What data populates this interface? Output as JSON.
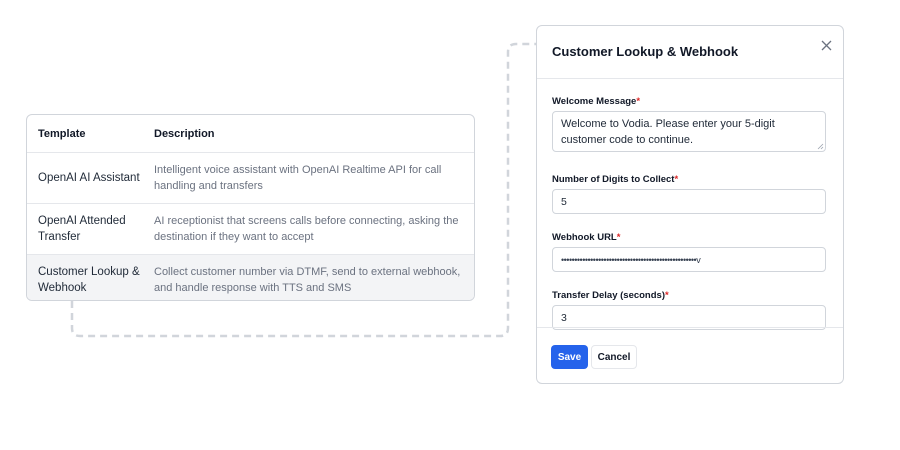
{
  "table": {
    "headers": {
      "template": "Template",
      "description": "Description"
    },
    "rows": [
      {
        "template": "OpenAI AI Assistant",
        "description": "Intelligent voice assistant with OpenAI Realtime API for call handling and transfers"
      },
      {
        "template": "OpenAI Attended Transfer",
        "description": "AI receptionist that screens calls before connecting, asking the destination if they want to accept"
      },
      {
        "template": "Customer Lookup & Webhook",
        "description": "Collect customer number via DTMF, send to external webhook, and handle response with TTS and SMS"
      }
    ]
  },
  "modal": {
    "title": "Customer Lookup & Webhook",
    "close_icon": "close-icon",
    "fields": {
      "welcome_message": {
        "label": "Welcome Message",
        "required_mark": "*",
        "value": "Welcome to Vodia. Please enter your 5-digit customer code to continue."
      },
      "digits": {
        "label": "Number of Digits to Collect",
        "required_mark": "*",
        "value": "5"
      },
      "webhook_url": {
        "label": "Webhook URL",
        "required_mark": "*",
        "value": "•••••••••••••••••••••••••••••••••••••••••••••••••••v"
      },
      "transfer_delay": {
        "label": "Transfer Delay (seconds)",
        "required_mark": "*",
        "value": "3"
      }
    },
    "buttons": {
      "save": "Save",
      "cancel": "Cancel"
    }
  },
  "colors": {
    "primary": "#2563eb",
    "required": "#dc2626",
    "selected_row": "#f3f4f6",
    "connector": "#d1d5db"
  }
}
